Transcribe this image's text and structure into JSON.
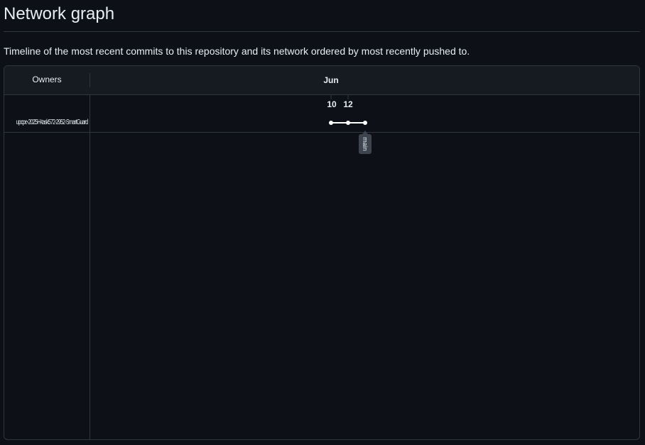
{
  "page": {
    "title": "Network graph",
    "description": "Timeline of the most recent commits to this repository and its network ordered by most recently pushed to."
  },
  "graph": {
    "owners_header": "Owners",
    "month": "Jun",
    "dates": [
      "10",
      "12"
    ],
    "owners": [
      {
        "name": "upcpe-2025H-task572-2952-SmartGuard",
        "branch": "main",
        "commits": 3
      }
    ],
    "colors": {
      "background": "#0d1117",
      "header_bg": "#161b22",
      "border": "#30363d",
      "commit_line": "#ffffff",
      "branch_tag_bg": "#3d444d"
    }
  }
}
